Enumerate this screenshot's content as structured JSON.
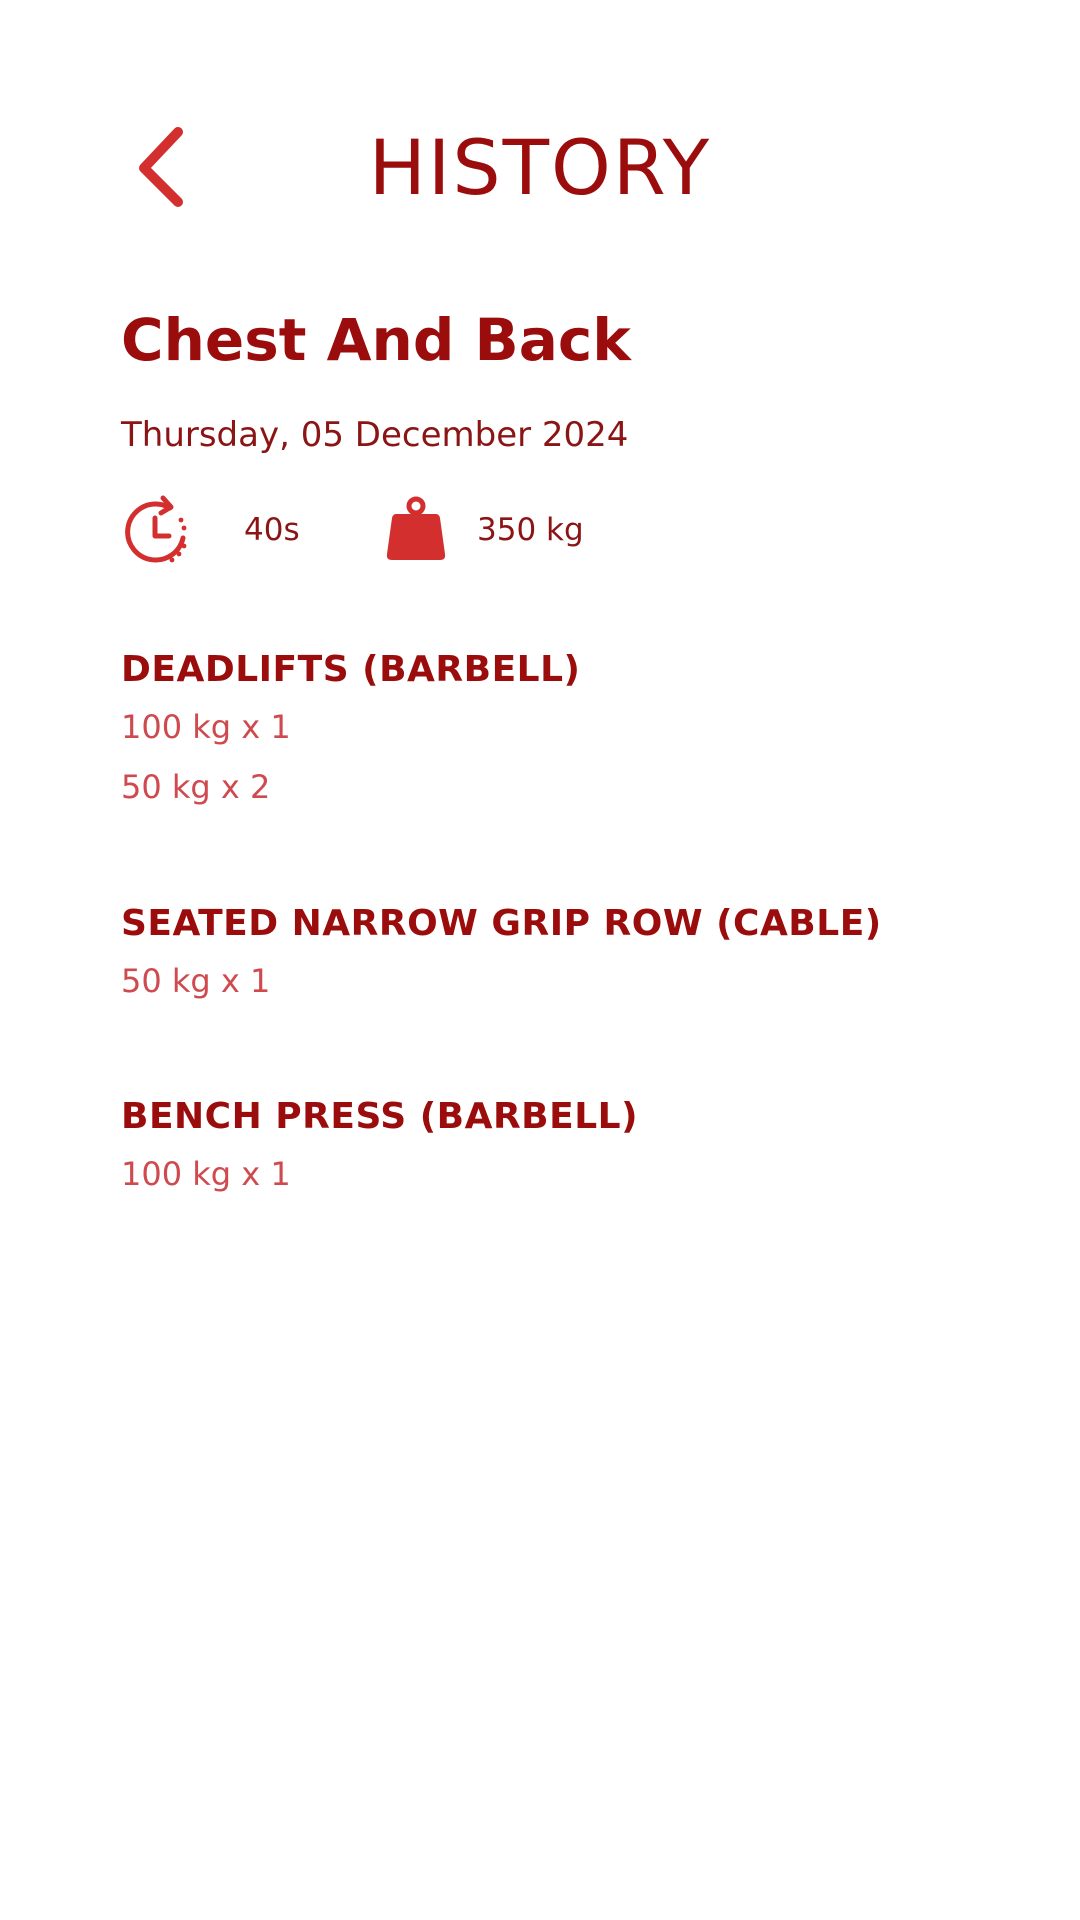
{
  "header": {
    "title": "HISTORY",
    "back_icon": "chevron-left-icon"
  },
  "workout": {
    "name": "Chest And Back",
    "date": "Thursday, 05 December 2024",
    "duration_icon": "timer-icon",
    "duration": "40s",
    "weight_icon": "kettlebell-weight-icon",
    "total_weight": "350 kg"
  },
  "exercises": [
    {
      "name": "DEADLIFTS (BARBELL)",
      "sets": [
        "100 kg x 1",
        "50 kg x 2"
      ]
    },
    {
      "name": "SEATED NARROW GRIP ROW (CABLE)",
      "sets": [
        "50 kg x 1"
      ]
    },
    {
      "name": "BENCH PRESS (BARBELL)",
      "sets": [
        "100 kg x 1"
      ]
    }
  ],
  "colors": {
    "title": "#9b0c0c",
    "icon_red": "#d32f2f",
    "set_text": "#cf4a4e",
    "background": "#ffffff"
  }
}
